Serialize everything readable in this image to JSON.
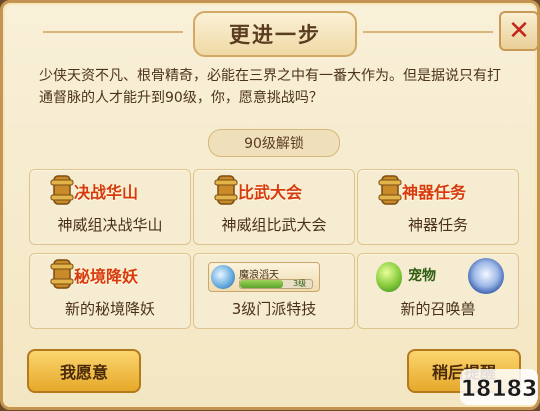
{
  "dialog": {
    "title": "更进一步",
    "intro": "少侠天资不凡、根骨精奇，必能在三界之中有一番大作为。但是据说只有打通督脉的人才能升到90级，你，愿意挑战吗？",
    "unlock_label": "90级解锁"
  },
  "cards": [
    {
      "tag": "决战华山",
      "caption": "神威组决战华山"
    },
    {
      "tag": "比武大会",
      "caption": "神威组比武大会"
    },
    {
      "tag": "神器任务",
      "caption": "神器任务"
    },
    {
      "tag": "秘境降妖",
      "caption": "新的秘境降妖"
    },
    {
      "skill_name": "魔浪滔天",
      "skill_level": "3级",
      "caption": "3级门派特技"
    },
    {
      "tag": "宠物",
      "caption": "新的召唤兽"
    }
  ],
  "buttons": {
    "accept": "我愿意",
    "later": "稍后提醒"
  },
  "watermark": "18183",
  "colors": {
    "accent_red": "#d83a10",
    "button_gold": "#e6a92a",
    "panel": "#f6ecd1"
  },
  "icons": {
    "close": "close-icon",
    "scroll": "scroll-icon",
    "skill": "skill-orb-icon",
    "egg": "pet-egg-icon",
    "beast": "summon-beast-icon"
  }
}
